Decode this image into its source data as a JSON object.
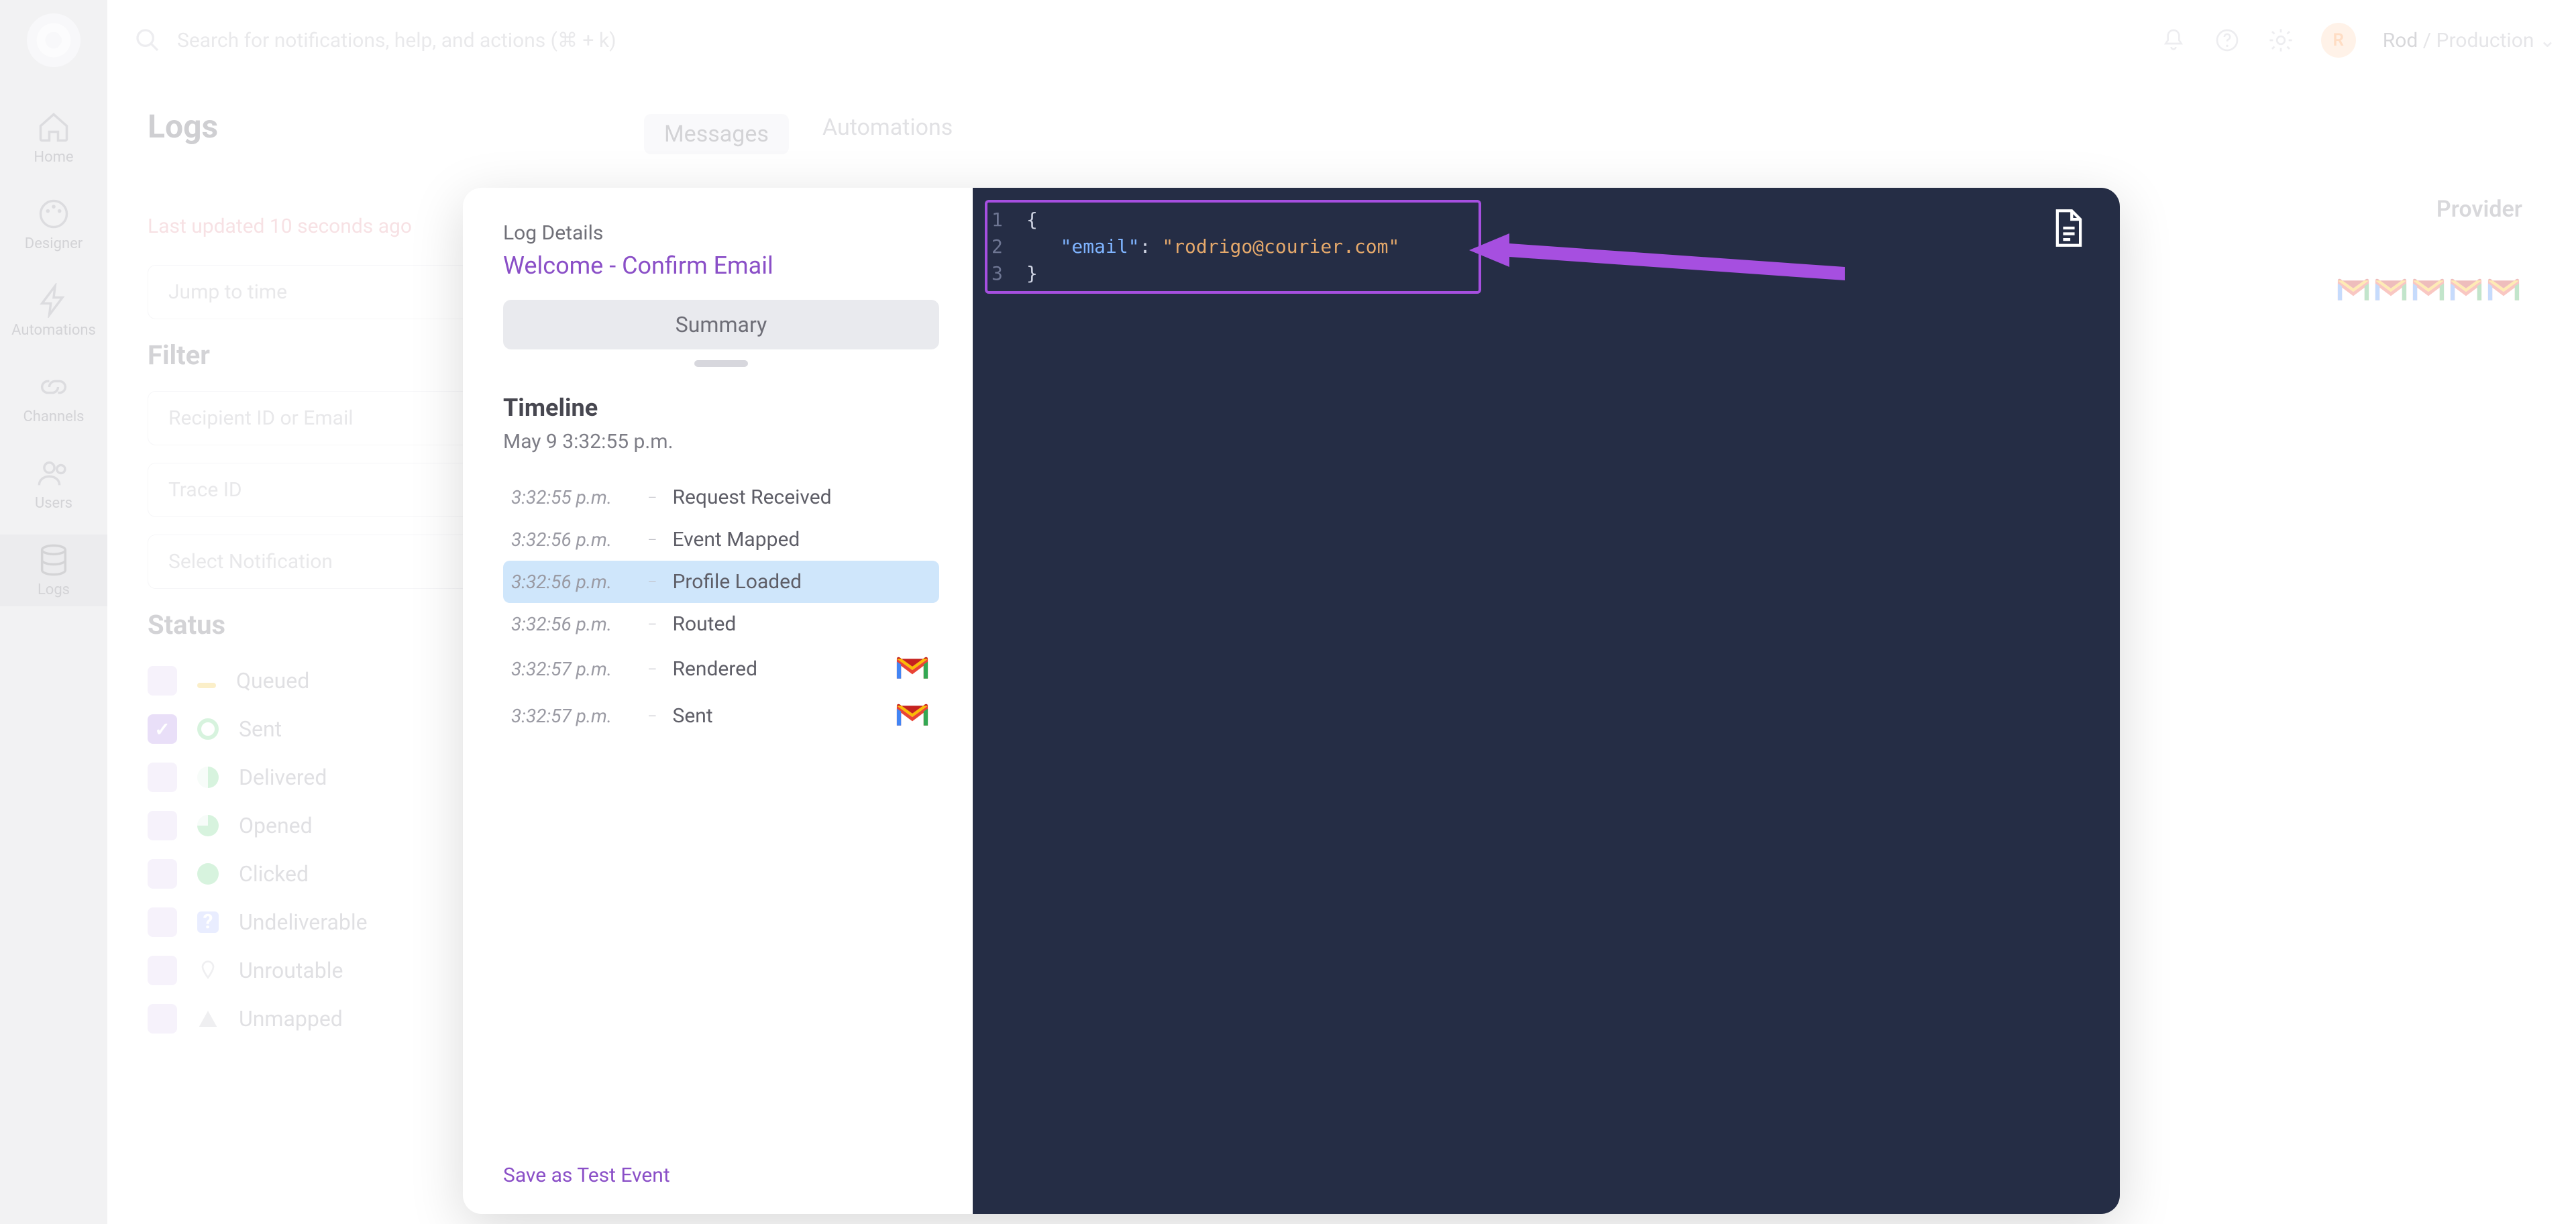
{
  "sidenav": {
    "items": [
      {
        "id": "home",
        "label": "Home"
      },
      {
        "id": "designer",
        "label": "Designer"
      },
      {
        "id": "automations",
        "label": "Automations"
      },
      {
        "id": "channels",
        "label": "Channels"
      },
      {
        "id": "users",
        "label": "Users"
      },
      {
        "id": "logs",
        "label": "Logs"
      }
    ],
    "active": "logs"
  },
  "topbar": {
    "search_placeholder": "Search for notifications, help, and actions (⌘ + k)",
    "user": "Rod",
    "workspace": "Production"
  },
  "page": {
    "title": "Logs",
    "tabs": [
      "Messages",
      "Automations"
    ],
    "active_tab": "Messages",
    "last_updated": "Last updated 10 seconds ago",
    "jump_placeholder": "Jump to time",
    "filter_heading": "Filter",
    "filters": {
      "recipient_placeholder": "Recipient ID or Email",
      "trace_placeholder": "Trace ID",
      "notification_placeholder": "Select Notification"
    },
    "status_heading": "Status",
    "statuses": [
      {
        "label": "Queued",
        "color": "#f2c94c",
        "checked": false,
        "shape": "dash"
      },
      {
        "label": "Sent",
        "color": "#7bd88f",
        "checked": true,
        "shape": "ring"
      },
      {
        "label": "Delivered",
        "color": "#7bd88f",
        "checked": false,
        "shape": "half"
      },
      {
        "label": "Opened",
        "color": "#7bd88f",
        "checked": false,
        "shape": "three-quarter"
      },
      {
        "label": "Clicked",
        "color": "#7bd88f",
        "checked": false,
        "shape": "full"
      },
      {
        "label": "Undeliverable",
        "color": "#8aa0ff",
        "checked": false,
        "shape": "square"
      },
      {
        "label": "Unroutable",
        "color": "#c9c9d0",
        "checked": false,
        "shape": "pin"
      },
      {
        "label": "Unmapped",
        "color": "#c9c9d0",
        "checked": false,
        "shape": "triangle"
      }
    ],
    "provider_header": "Provider",
    "provider_rows": 5
  },
  "modal": {
    "header_small": "Log Details",
    "title": "Welcome - Confirm Email",
    "summary_label": "Summary",
    "timeline_title": "Timeline",
    "timeline_date": "May 9 3:32:55 p.m.",
    "events": [
      {
        "time": "3:32:55 p.m.",
        "label": "Request Received",
        "provider": false
      },
      {
        "time": "3:32:56 p.m.",
        "label": "Event Mapped",
        "provider": false
      },
      {
        "time": "3:32:56 p.m.",
        "label": "Profile Loaded",
        "provider": false,
        "active": true
      },
      {
        "time": "3:32:56 p.m.",
        "label": "Routed",
        "provider": false
      },
      {
        "time": "3:32:57 p.m.",
        "label": "Rendered",
        "provider": true
      },
      {
        "time": "3:32:57 p.m.",
        "label": "Sent",
        "provider": true
      }
    ],
    "save_test_label": "Save as Test Event",
    "code": {
      "lines": [
        "1",
        "2",
        "3"
      ],
      "body_open": "{",
      "key": "\"email\"",
      "colon": ": ",
      "value": "\"rodrigo@courier.com\"",
      "body_close": "}"
    }
  }
}
